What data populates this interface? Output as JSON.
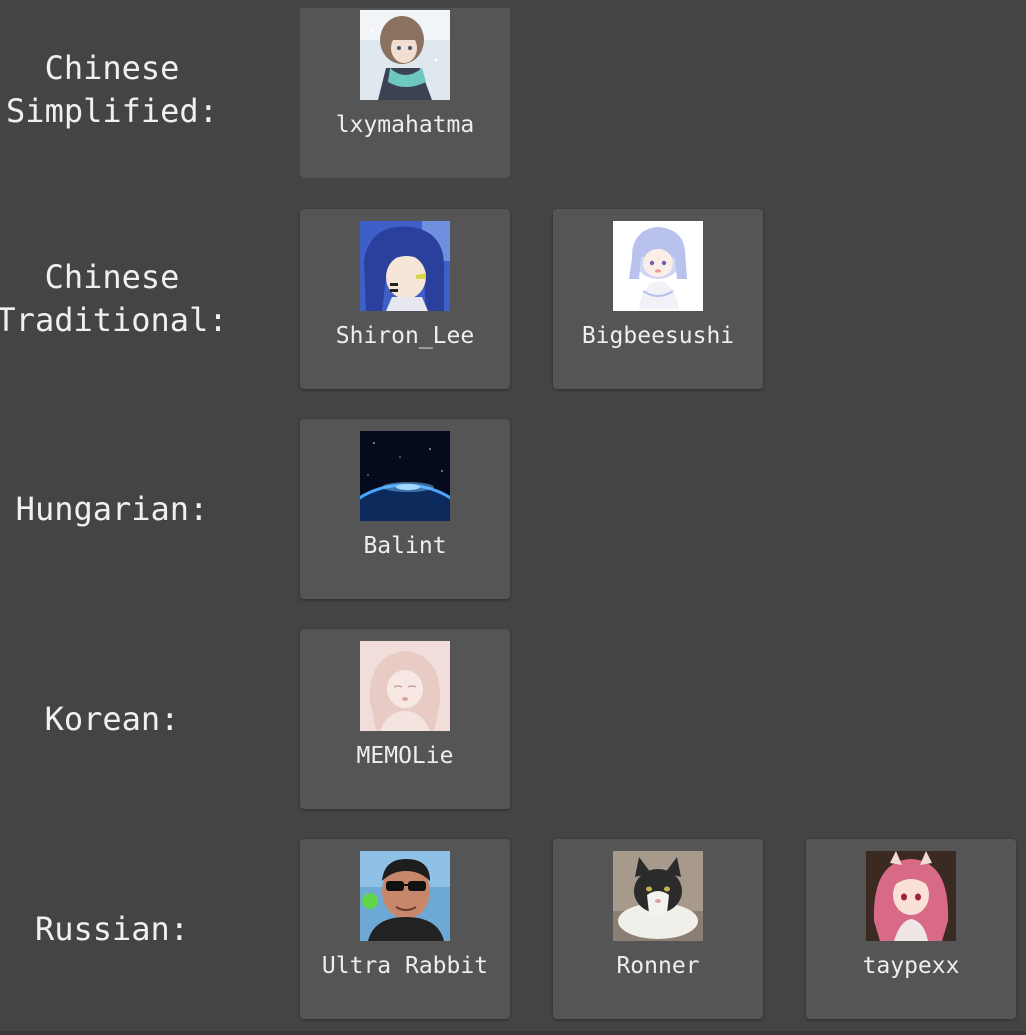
{
  "groups": [
    {
      "language": "Chinese\nSimplified:",
      "translators": [
        {
          "name": "lxymahatma",
          "avatar": "anime-girl-scarf-avatar"
        }
      ]
    },
    {
      "language": "Chinese\nTraditional:",
      "translators": [
        {
          "name": "Shiron_Lee",
          "avatar": "anime-blue-hair-avatar"
        },
        {
          "name": "Bigbeesushi",
          "avatar": "chibi-silver-hair-avatar"
        }
      ]
    },
    {
      "language": "Hungarian:",
      "translators": [
        {
          "name": "Balint",
          "avatar": "earth-from-space-avatar"
        }
      ]
    },
    {
      "language": "Korean:",
      "translators": [
        {
          "name": "MEMOLie",
          "avatar": "pink-anime-sketch-avatar"
        }
      ]
    },
    {
      "language": "Russian:",
      "translators": [
        {
          "name": "Ultra Rabbit",
          "avatar": "man-sunglasses-avatar"
        },
        {
          "name": "Ronner",
          "avatar": "black-white-cat-avatar"
        },
        {
          "name": "taypexx",
          "avatar": "anime-pink-hair-avatar"
        }
      ]
    }
  ]
}
